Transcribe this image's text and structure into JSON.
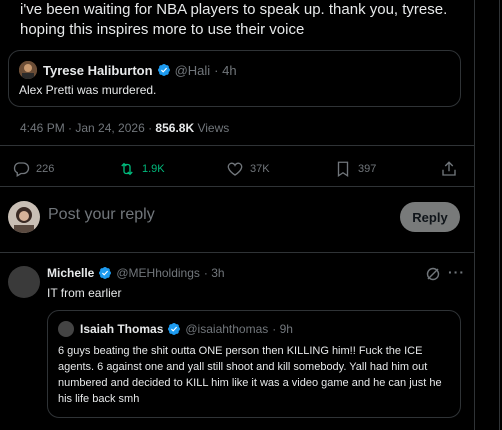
{
  "tweet": {
    "text": "i've been waiting for NBA players to speak up. thank you, tyrese. hoping this inspires more to use their voice",
    "quoted": {
      "author_name": "Tyrese Haliburton",
      "handle": "@Hali",
      "time": "· 4h",
      "text": "Alex Pretti was murdered."
    },
    "meta": {
      "timestamp": "4:46 PM · Jan 24, 2026 ·",
      "views": "856.8K",
      "views_label": "Views"
    },
    "actions": {
      "replies": "226",
      "retweets": "1.9K",
      "likes": "37K",
      "bookmarks": "397"
    }
  },
  "composer": {
    "placeholder": "Post your reply",
    "button_label": "Reply"
  },
  "reply": {
    "author_name": "Michelle",
    "handle": "@MEHholdings",
    "time": "· 3h",
    "text": "IT from earlier",
    "quoted": {
      "author_name": "Isaiah Thomas",
      "handle": "@isaiahthomas",
      "time": "· 9h",
      "text": "6 guys beating the shit outta ONE person then KILLING him!! Fuck the ICE agents. 6 against one and yall still shoot and kill somebody. Yall had him out numbered and decided to KILL him like it was a video game and he can just he his life back smh"
    },
    "more_label": "···"
  },
  "colors": {
    "background": "#000000",
    "text": "#e7e9ea",
    "muted": "#71767b",
    "border": "#2f3336",
    "verified": "#1d9bf0",
    "retweet_active": "#00ba7c",
    "reply_button_bg": "#787a7a"
  }
}
